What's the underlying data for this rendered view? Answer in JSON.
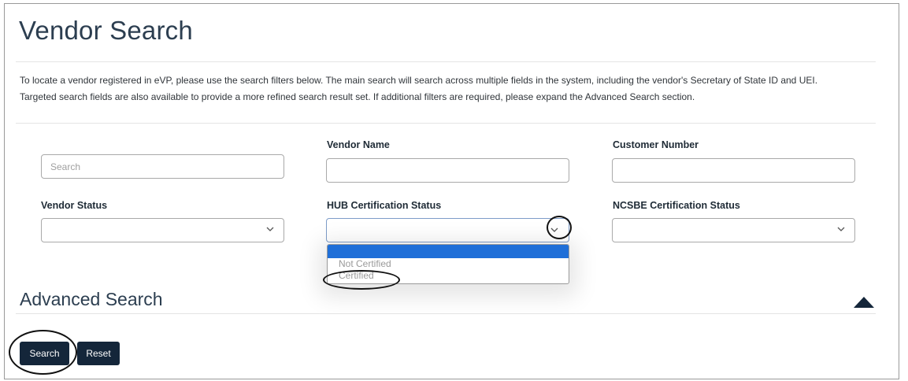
{
  "page": {
    "title": "Vendor Search",
    "description_line1": "To locate a vendor registered in eVP, please use the search filters below. The main search will search across multiple fields in the system, including the vendor's Secretary of State ID and UEI.",
    "description_line2": "Targeted search fields are also available to provide a more refined search result set. If additional filters are required, please expand the Advanced Search section."
  },
  "filters": {
    "search": {
      "placeholder": "Search",
      "value": ""
    },
    "vendor_name": {
      "label": "Vendor Name",
      "value": ""
    },
    "customer_number": {
      "label": "Customer Number",
      "value": ""
    },
    "vendor_status": {
      "label": "Vendor Status",
      "value": ""
    },
    "hub_certification_status": {
      "label": "HUB Certification Status",
      "value": "",
      "options": [
        "",
        "Not Certified",
        "Certified"
      ],
      "highlighted_option": ""
    },
    "ncsbe_certification_status": {
      "label": "NCSBE Certification Status",
      "value": ""
    }
  },
  "advanced_search": {
    "title": "Advanced Search",
    "expanded": true,
    "toggle_icon": "triangle-up-icon"
  },
  "actions": {
    "search_label": "Search",
    "reset_label": "Reset"
  },
  "colors": {
    "primary_button": "#14263a",
    "highlight": "#1f6fd8",
    "title_text": "#2c3e50"
  }
}
